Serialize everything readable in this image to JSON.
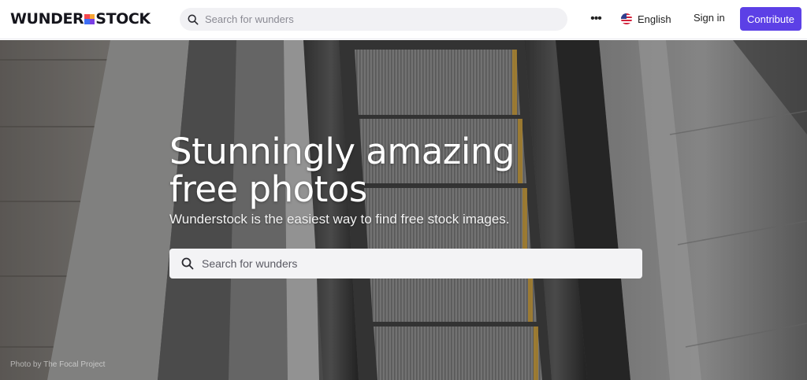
{
  "header": {
    "logo_left": "WUNDER",
    "logo_right": "STOCK",
    "search_placeholder": "Search for wunders",
    "more_label": "•••",
    "language": "English",
    "signin_label": "Sign in",
    "contribute_label": "Contribute"
  },
  "hero": {
    "title_line1": "Stunningly amazing",
    "title_line2": "free photos",
    "subtitle": "Wunderstock is the easiest way to find free stock images.",
    "search_placeholder": "Search for wunders",
    "credit_prefix": "Photo by",
    "credit_author": "The Focal Project"
  },
  "colors": {
    "accent": "#5c40e6",
    "logo_red": "#f5474d",
    "logo_orange": "#f8a534",
    "logo_blue": "#3e6ef4",
    "logo_purple": "#7b3fe4"
  },
  "icons": {
    "search": "search-icon",
    "more": "more-horizontal-icon",
    "flag": "us-flag-icon"
  }
}
